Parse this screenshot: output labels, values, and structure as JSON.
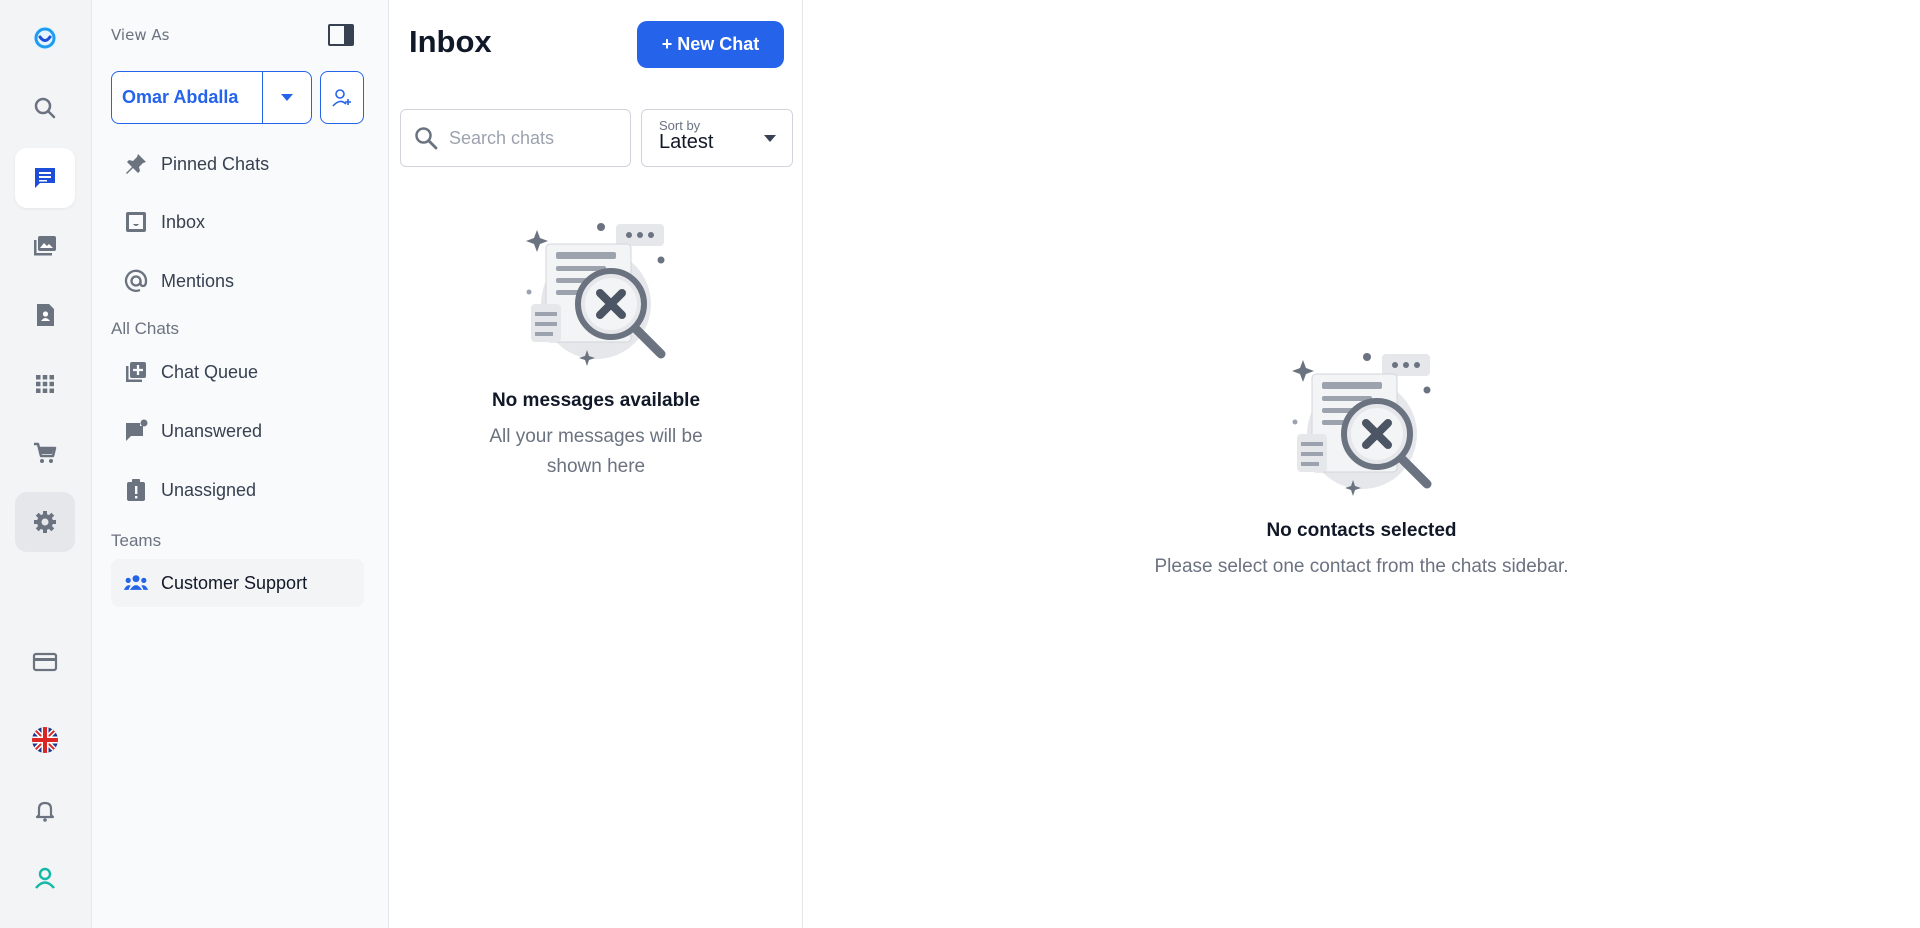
{
  "sidebar": {
    "view_as_label": "View As",
    "selected_user": "Omar Abdalla",
    "items": [
      {
        "label": "Pinned Chats"
      },
      {
        "label": "Inbox"
      },
      {
        "label": "Mentions"
      }
    ],
    "all_chats_label": "All Chats",
    "all_chats": [
      {
        "label": "Chat Queue"
      },
      {
        "label": "Unanswered"
      },
      {
        "label": "Unassigned"
      }
    ],
    "teams_label": "Teams",
    "teams": [
      {
        "label": "Customer Support"
      }
    ]
  },
  "inbox": {
    "title": "Inbox",
    "new_chat_label": "+ New Chat",
    "search_placeholder": "Search chats",
    "sort_label": "Sort by",
    "sort_value": "Latest",
    "empty_title": "No messages available",
    "empty_subtitle": "All your messages will be shown here"
  },
  "main": {
    "empty_title": "No contacts selected",
    "empty_subtitle": "Please select one contact from the chats sidebar."
  },
  "colors": {
    "accent": "#2563eb",
    "rail_bg": "#f3f4f6"
  },
  "icons": [
    "app-logo-icon",
    "search-icon",
    "chat-icon",
    "media-library-icon",
    "contact-card-icon",
    "apps-grid-icon",
    "cart-icon",
    "settings-icon",
    "credit-card-icon",
    "uk-flag-icon",
    "bell-icon",
    "profile-icon"
  ]
}
